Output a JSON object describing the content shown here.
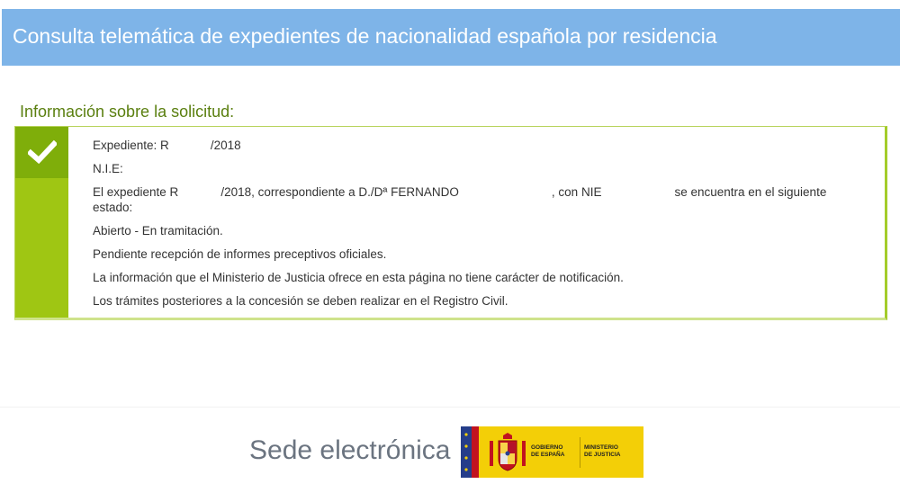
{
  "header": {
    "title": "Consulta telemática de expedientes de nacionalidad española por residencia"
  },
  "section": {
    "title": "Información sobre la solicitud:"
  },
  "info": {
    "expediente_label": "Expediente: R",
    "expediente_suffix": "/2018",
    "nie_label": "N.I.E:",
    "estado_part1": "El expediente R",
    "estado_part2": "/2018, correspondiente a D./Dª FERNANDO",
    "estado_part3": ", con NIE",
    "estado_part4": "se encuentra en el siguiente",
    "estado_part5": "estado:",
    "status": "Abierto - En tramitación.",
    "pending": "Pendiente recepción de informes preceptivos oficiales.",
    "notice": "La información que el Ministerio de Justicia ofrece en esta página no tiene carácter de notificación.",
    "tramites": "Los trámites posteriores a la concesión se deben realizar en el Registro Civil."
  },
  "footer": {
    "sede_label": "Sede electrónica",
    "gobierno_line1": "GOBIERNO",
    "gobierno_line2": "DE ESPAÑA",
    "ministerio_line1": "MINISTERIO",
    "ministerio_line2": "DE JUSTICIA"
  },
  "colors": {
    "header_bg": "#7eb4e8",
    "accent_green": "#9fc613",
    "title_green": "#5a7f0f",
    "logo_yellow": "#f3cf07"
  },
  "icons": {
    "status": "check-icon",
    "shield": "coat-of-arms-icon"
  }
}
